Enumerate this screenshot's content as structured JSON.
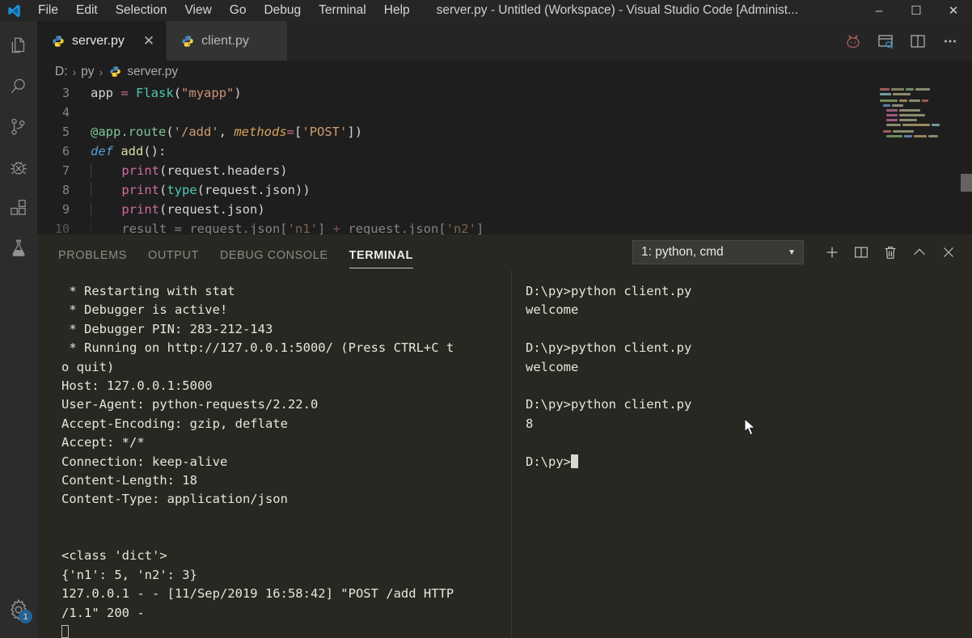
{
  "window": {
    "title": "server.py - Untitled (Workspace) - Visual Studio Code [Administ...",
    "logo_name": "vscode-logo",
    "minimize": "–",
    "maximize": "☐",
    "close": "✕"
  },
  "menubar": {
    "items": [
      "File",
      "Edit",
      "Selection",
      "View",
      "Go",
      "Debug",
      "Terminal",
      "Help"
    ]
  },
  "activitybar": {
    "items": [
      {
        "name": "explorer-icon",
        "label": "Explorer"
      },
      {
        "name": "search-icon",
        "label": "Search"
      },
      {
        "name": "source-control-icon",
        "label": "Source Control"
      },
      {
        "name": "debug-icon",
        "label": "Debug"
      },
      {
        "name": "extensions-icon",
        "label": "Extensions"
      },
      {
        "name": "testing-flask-icon",
        "label": "Testing"
      }
    ],
    "settings": {
      "name": "settings-gear-icon",
      "badge": "1"
    }
  },
  "tabs": [
    {
      "label": "server.py",
      "icon": "python-icon",
      "active": true,
      "closable": true
    },
    {
      "label": "client.py",
      "icon": "python-icon",
      "active": false,
      "closable": false
    }
  ],
  "editor_actions": [
    {
      "name": "run-flask-icon",
      "label": "Run"
    },
    {
      "name": "preview-search-icon",
      "label": "Preview"
    },
    {
      "name": "split-editor-icon",
      "label": "Split Editor"
    },
    {
      "name": "more-actions-icon",
      "label": "More Actions..."
    }
  ],
  "breadcrumb": {
    "items": [
      "D:",
      "py",
      "server.py"
    ],
    "separator": "›",
    "file_icon": "python-icon"
  },
  "code": {
    "lines": [
      {
        "num": "3",
        "text": "app = Flask(\"myapp\")"
      },
      {
        "num": "4",
        "text": ""
      },
      {
        "num": "5",
        "text": "@app.route('/add', methods=['POST'])"
      },
      {
        "num": "6",
        "text": "def add():"
      },
      {
        "num": "7",
        "text": "    print(request.headers)"
      },
      {
        "num": "8",
        "text": "    print(type(request.json))"
      },
      {
        "num": "9",
        "text": "    print(request.json)"
      },
      {
        "num": "10",
        "text": "    result = request.json['n1'] + request.json['n2']"
      }
    ]
  },
  "panel": {
    "tabs": [
      "PROBLEMS",
      "OUTPUT",
      "DEBUG CONSOLE",
      "TERMINAL"
    ],
    "active_tab": "TERMINAL",
    "terminal_select": {
      "value": "1: python, cmd",
      "caret": "▼"
    },
    "actions": [
      {
        "name": "new-terminal-icon",
        "label": "New Terminal"
      },
      {
        "name": "split-terminal-icon",
        "label": "Split Terminal"
      },
      {
        "name": "kill-terminal-icon",
        "label": "Kill Terminal"
      },
      {
        "name": "chevron-up-icon",
        "label": "Maximize Panel"
      },
      {
        "name": "close-panel-icon",
        "label": "Close Panel"
      }
    ]
  },
  "terminal_left": {
    "lines": [
      " * Restarting with stat",
      " * Debugger is active!",
      " * Debugger PIN: 283-212-143",
      " * Running on http://127.0.0.1:5000/ (Press CTRL+C t",
      "o quit)",
      "Host: 127.0.0.1:5000",
      "User-Agent: python-requests/2.22.0",
      "Accept-Encoding: gzip, deflate",
      "Accept: */*",
      "Connection: keep-alive",
      "Content-Length: 18",
      "Content-Type: application/json",
      "",
      "",
      "<class 'dict'>",
      "{'n1': 5, 'n2': 3}",
      "127.0.0.1 - - [11/Sep/2019 16:58:42] \"POST /add HTTP",
      "/1.1\" 200 -"
    ],
    "end_marker": "box-glyph"
  },
  "terminal_right": {
    "lines": [
      "D:\\py>python client.py",
      "welcome",
      "",
      "D:\\py>python client.py",
      "welcome",
      "",
      "D:\\py>python client.py",
      "8",
      "",
      "D:\\py>"
    ],
    "cursor": "block"
  },
  "colors": {
    "accent": "#1a85d6",
    "editor_bg": "#1e1e1e",
    "terminal_bg": "#272822",
    "activitybar_bg": "#2c2c2c"
  }
}
